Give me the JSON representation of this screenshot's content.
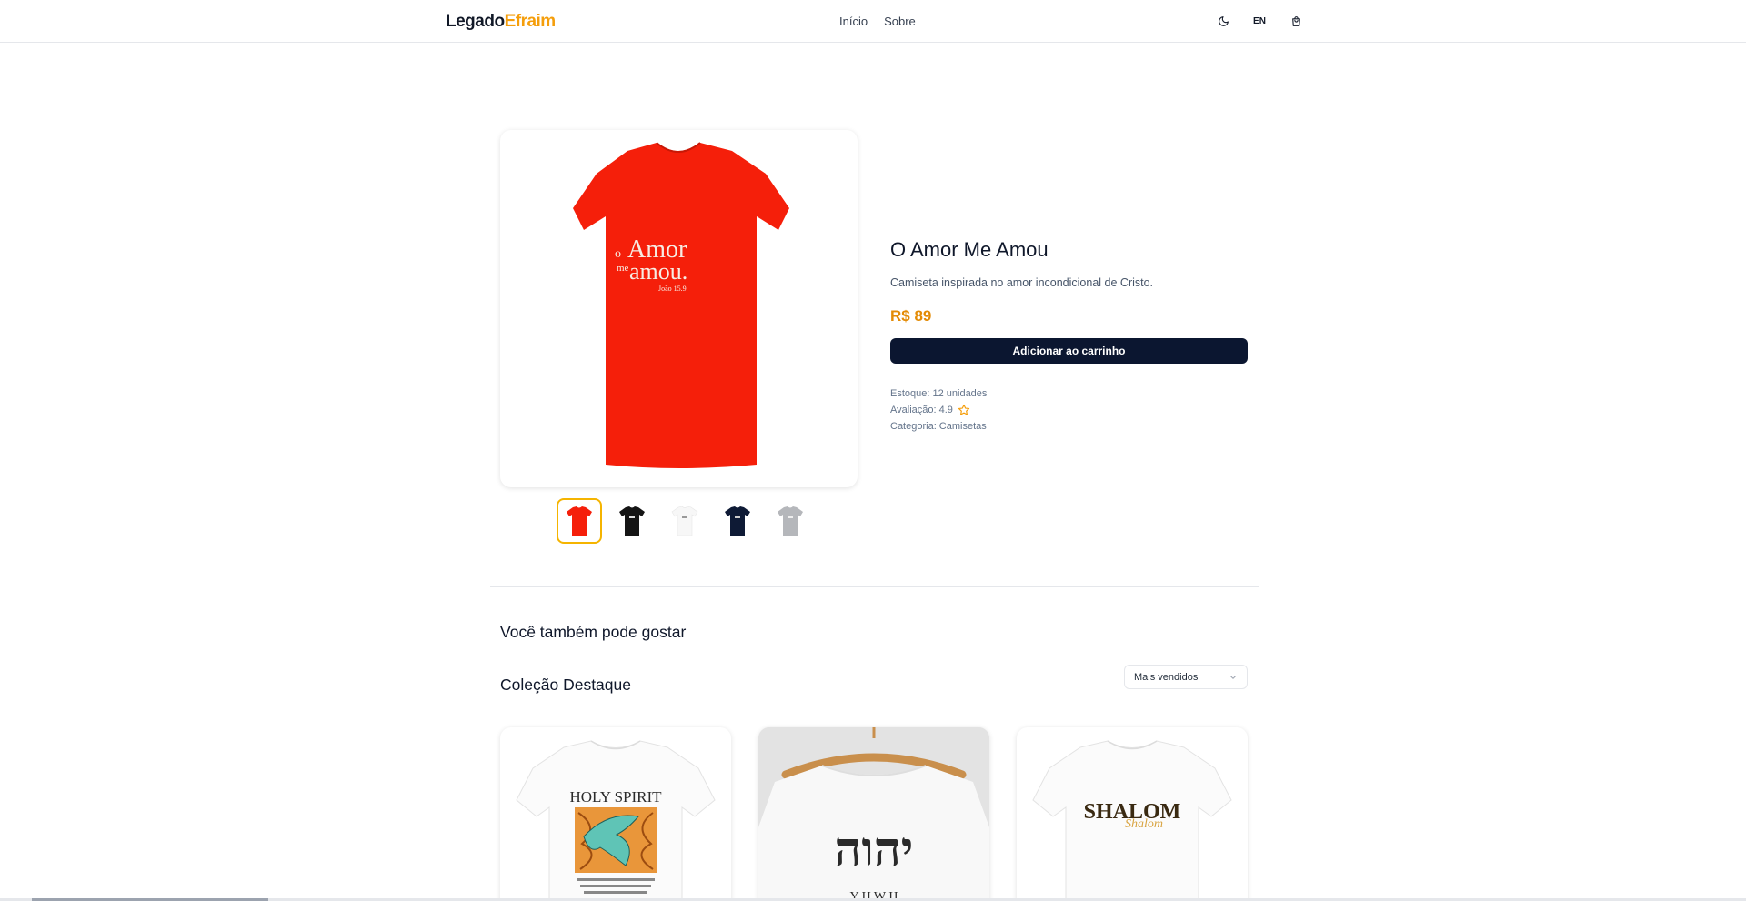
{
  "header": {
    "logo_part1": "Legado",
    "logo_part2": "Efraim",
    "nav": [
      "Início",
      "Sobre"
    ],
    "lang": "EN"
  },
  "product": {
    "title": "O Amor Me Amou",
    "description": "Camiseta inspirada no amor incondicional de Cristo.",
    "price": "R$ 89",
    "add_to_cart": "Adicionar ao carrinho",
    "stock": "Estoque: 12 unidades",
    "rating_label": "Avaliação: 4.9",
    "category": "Categoria: Camisetas",
    "print": {
      "o": "o",
      "amor": "Amor",
      "me": "me",
      "amou": "amou.",
      "ref": "João 15.9"
    },
    "shirt_color": "#f51f0a",
    "thumbnail_colors": [
      "#f51f0a",
      "#151515",
      "#f7f7f7",
      "#0e1a35",
      "#b5b7bb"
    ]
  },
  "related": {
    "heading": "Você também pode gostar",
    "collection_title": "Coleção Destaque",
    "sort_label": "Mais vendidos",
    "cards": [
      {
        "print_title": "HOLY SPIRIT"
      },
      {
        "print_title": "יהוה",
        "print_sub": "Y H W H"
      },
      {
        "print_title": "SHALOM",
        "print_sub": "Shalom"
      }
    ]
  },
  "colors": {
    "accent": "#f59e0b",
    "price": "#e38b06",
    "button": "#0b1630",
    "thumb_active_border": "#f5b400"
  }
}
